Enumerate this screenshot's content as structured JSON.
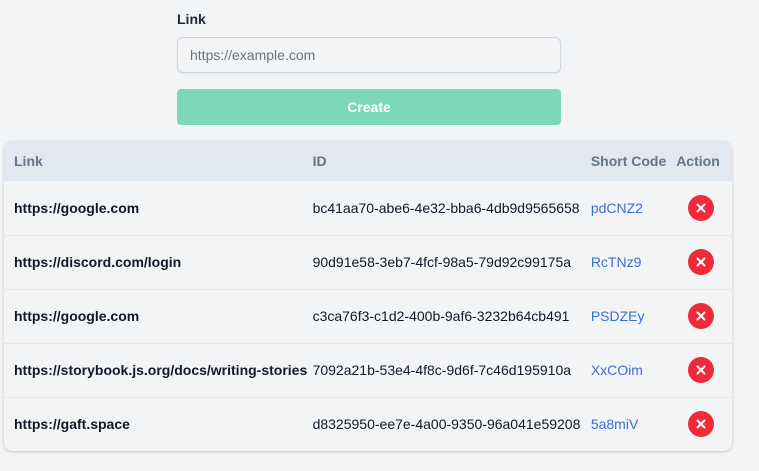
{
  "form": {
    "label": "Link",
    "input_value": "",
    "input_placeholder": "https://example.com",
    "create_label": "Create"
  },
  "table": {
    "headers": {
      "link": "Link",
      "id": "ID",
      "short_code": "Short Code",
      "action": "Action"
    },
    "rows": [
      {
        "link": "https://google.com",
        "id": "bc41aa70-abe6-4e32-bba6-4db9d9565658",
        "short_code": "pdCNZ2"
      },
      {
        "link": "https://discord.com/login",
        "id": "90d91e58-3eb7-4fcf-98a5-79d92c99175a",
        "short_code": "RcTNz9"
      },
      {
        "link": "https://google.com",
        "id": "c3ca76f3-c1d2-400b-9af6-3232b64cb491",
        "short_code": "PSDZEy"
      },
      {
        "link": "https://storybook.js.org/docs/writing-stories",
        "id": "7092a21b-53e4-4f8c-9d6f-7c46d195910a",
        "short_code": "XxCOim"
      },
      {
        "link": "https://gaft.space",
        "id": "d8325950-ee7e-4a00-9350-96a041e59208",
        "short_code": "5a8miV"
      }
    ]
  },
  "icons": {
    "delete": "close-circle-icon"
  },
  "colors": {
    "create_button": "#7dd8ba",
    "short_code_link": "#3b6fd1",
    "delete_button": "#ef2b3a",
    "table_header_bg": "#e2e8f0"
  }
}
